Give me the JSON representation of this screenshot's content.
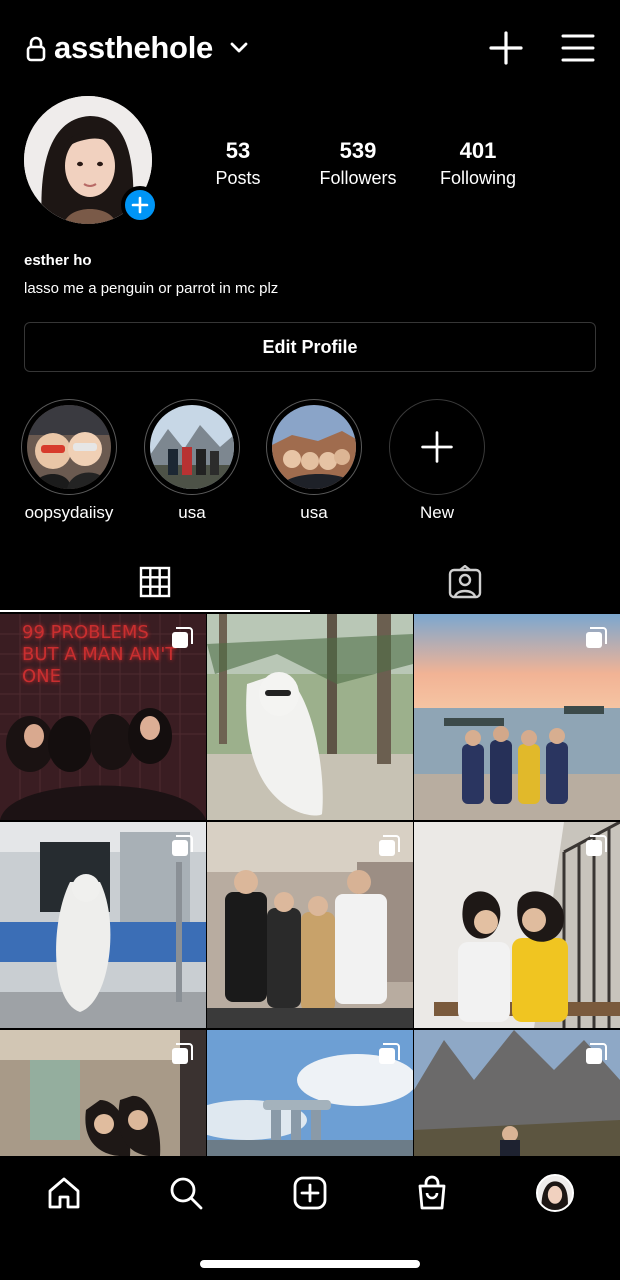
{
  "header": {
    "username": "assthehole",
    "lock_icon": "lock-icon",
    "dropdown_icon": "chevron-down-icon",
    "new_post_icon": "plus-icon",
    "menu_icon": "hamburger-menu-icon"
  },
  "profile": {
    "posts_count": "53",
    "posts_label": "Posts",
    "followers_count": "539",
    "followers_label": "Followers",
    "following_count": "401",
    "following_label": "Following",
    "full_name": "esther ho",
    "bio": "lasso me a penguin or parrot in mc plz",
    "edit_label": "Edit Profile"
  },
  "highlights": [
    {
      "label": "oopsydaiisy"
    },
    {
      "label": "usa"
    },
    {
      "label": "usa"
    },
    {
      "label": "New"
    }
  ],
  "tabs": {
    "active": "grid",
    "items": [
      "grid-icon",
      "tagged-icon"
    ]
  },
  "posts": [
    {
      "overlay_text": [
        "99 PROBLEMS",
        "BUT A MAN AIN'T ONE"
      ],
      "multi": true
    },
    {
      "multi": false
    },
    {
      "multi": true
    },
    {
      "multi": true
    },
    {
      "multi": true
    },
    {
      "multi": true
    },
    {
      "multi": true
    },
    {
      "multi": true
    },
    {
      "multi": true
    }
  ],
  "nav": {
    "items": [
      "home-icon",
      "search-icon",
      "new-post-icon",
      "shop-icon",
      "profile-avatar"
    ]
  },
  "colors": {
    "background": "#000000",
    "accent_blue": "#0095f6",
    "border": "#363636"
  }
}
